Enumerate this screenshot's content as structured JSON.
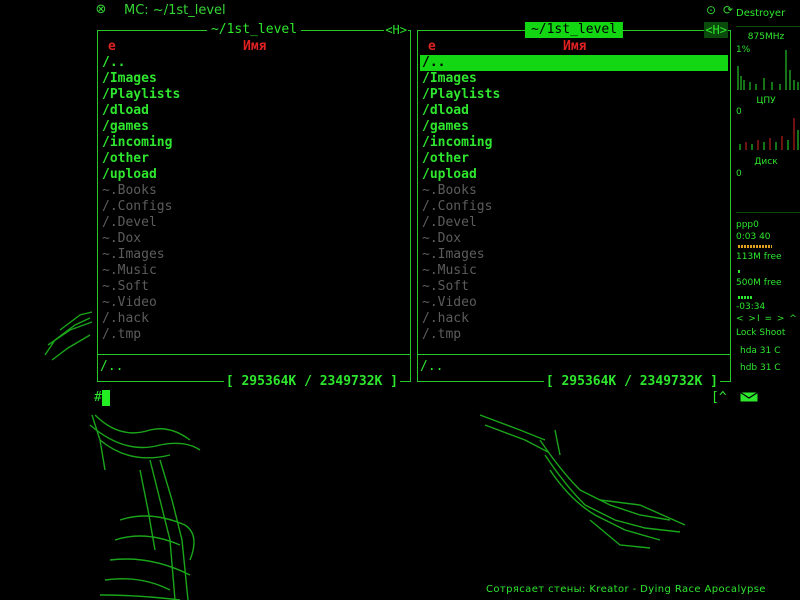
{
  "window": {
    "title": "MC: ~/1st_level",
    "close_icon": "close-circle-icon",
    "buttons": [
      {
        "name": "maximize-circle-icon",
        "glyph": "⊙"
      },
      {
        "name": "refresh-icon",
        "glyph": "⟳"
      }
    ]
  },
  "left_panel": {
    "title": "~/1st_level",
    "tag": "<H>",
    "col_e": "e",
    "col_name": "Имя",
    "rows": [
      {
        "name": "/..",
        "kind": "dir"
      },
      {
        "name": "/Images",
        "kind": "dir"
      },
      {
        "name": "/Playlists",
        "kind": "dir"
      },
      {
        "name": "/dload",
        "kind": "dir"
      },
      {
        "name": "/games",
        "kind": "dir"
      },
      {
        "name": "/incoming",
        "kind": "dir"
      },
      {
        "name": "/other",
        "kind": "dir"
      },
      {
        "name": "/upload",
        "kind": "dir"
      },
      {
        "name": "~.Books",
        "kind": "hid"
      },
      {
        "name": "/.Configs",
        "kind": "hid"
      },
      {
        "name": "/.Devel",
        "kind": "hid"
      },
      {
        "name": "~.Dox",
        "kind": "hid"
      },
      {
        "name": "~.Images",
        "kind": "hid"
      },
      {
        "name": "~.Music",
        "kind": "hid"
      },
      {
        "name": "~.Soft",
        "kind": "hid"
      },
      {
        "name": "~.Video",
        "kind": "hid"
      },
      {
        "name": "/.hack",
        "kind": "hid"
      },
      {
        "name": "/.tmp",
        "kind": "hid"
      }
    ],
    "mini_status": "/..",
    "free_info": "[ 295364K / 2349732K ]"
  },
  "right_panel": {
    "title": "~/1st_level",
    "tag": "<H>",
    "col_e": "e",
    "col_name": "Имя",
    "rows": [
      {
        "name": "/..",
        "kind": "sel"
      },
      {
        "name": "/Images",
        "kind": "dir"
      },
      {
        "name": "/Playlists",
        "kind": "dir"
      },
      {
        "name": "/dload",
        "kind": "dir"
      },
      {
        "name": "/games",
        "kind": "dir"
      },
      {
        "name": "/incoming",
        "kind": "dir"
      },
      {
        "name": "/other",
        "kind": "dir"
      },
      {
        "name": "/upload",
        "kind": "dir"
      },
      {
        "name": "~.Books",
        "kind": "hid"
      },
      {
        "name": "/.Configs",
        "kind": "hid"
      },
      {
        "name": "/.Devel",
        "kind": "hid"
      },
      {
        "name": "~.Dox",
        "kind": "hid"
      },
      {
        "name": "~.Images",
        "kind": "hid"
      },
      {
        "name": "~.Music",
        "kind": "hid"
      },
      {
        "name": "~.Soft",
        "kind": "hid"
      },
      {
        "name": "~.Video",
        "kind": "hid"
      },
      {
        "name": "/.hack",
        "kind": "hid"
      },
      {
        "name": "/.tmp",
        "kind": "hid"
      }
    ],
    "mini_status": "/..",
    "free_info": "[ 295364K / 2349732K ]"
  },
  "command_line": {
    "prompt": "#",
    "hint": "[^"
  },
  "monitor": {
    "hostname": "Destroyer",
    "cpu_freq": "875MHz",
    "cpu_percent": "1%",
    "cpu_label": "ЦПУ",
    "cpu_value": "0",
    "disk_label": "Диск",
    "disk_value": "0",
    "net_iface": "ppp0",
    "net_time": "0:03 40",
    "mem_free": "113M free",
    "swap_free": "500M free",
    "media_time": "-03:34",
    "media_controls": "< >I = > ^",
    "lock_label": "Lock Shoot",
    "hda_temp": "hda 31 C",
    "hdb_temp": "hdb 31 C"
  },
  "now_playing": "Сотрясает стены: Kreator - Dying Race Apocalypse",
  "colors": {
    "accent": "#2ee62e",
    "header_red": "#e02222",
    "hidden_gray": "#5c5c5c",
    "background": "#000000"
  }
}
